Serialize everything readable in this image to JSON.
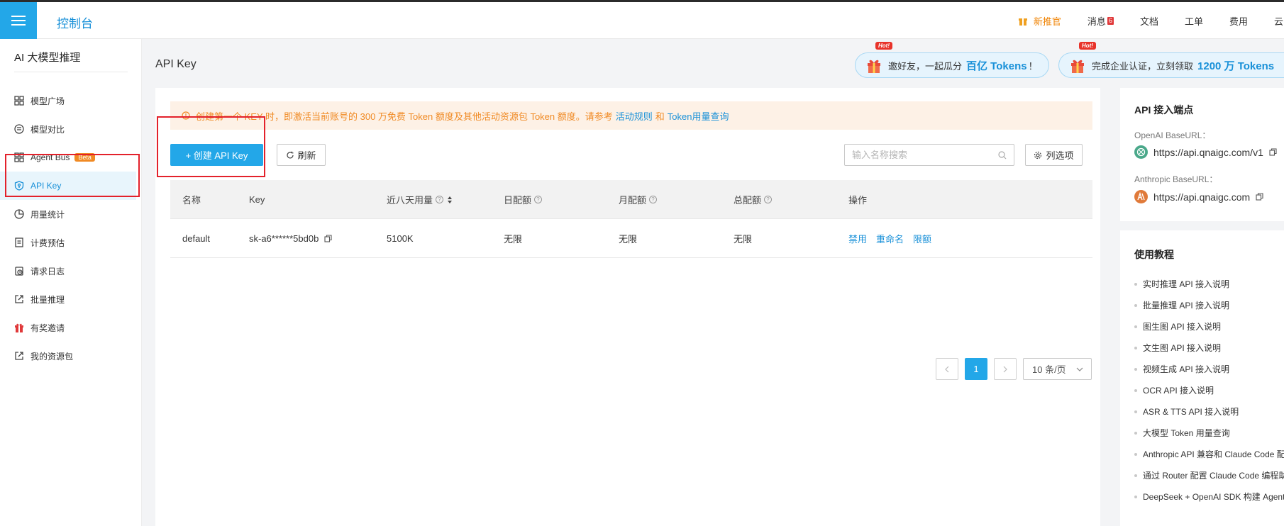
{
  "topbar": {
    "brand": "控制台",
    "nav": [
      "新推官",
      "消息",
      "文档",
      "工单",
      "费用",
      "云"
    ],
    "msg_badge": "6"
  },
  "sidebar": {
    "title": "AI 大模型推理",
    "items": [
      {
        "label": "模型广场",
        "icon": "grid-icon"
      },
      {
        "label": "模型对比",
        "icon": "compare-icon"
      },
      {
        "label": "Agent Bus",
        "icon": "grid-icon",
        "badge": "Beta"
      },
      {
        "label": "API Key",
        "icon": "shield-key-icon",
        "active": true
      },
      {
        "label": "用量统计",
        "icon": "pie-chart-icon"
      },
      {
        "label": "计费预估",
        "icon": "document-icon"
      },
      {
        "label": "请求日志",
        "icon": "clock-log-icon"
      },
      {
        "label": "批量推理",
        "icon": "external-icon"
      },
      {
        "label": "有奖邀请",
        "icon": "gift-icon"
      },
      {
        "label": "我的资源包",
        "icon": "external-icon"
      }
    ]
  },
  "page": {
    "title": "API Key"
  },
  "promos": [
    {
      "hot": "Hot!",
      "text": "邀好友，一起瓜分",
      "strong": "百亿 Tokens",
      "suffix": "！"
    },
    {
      "hot": "Hot!",
      "text": "完成企业认证，立刻领取",
      "strong": "1200 万 Tokens",
      "suffix": ""
    }
  ],
  "notice": {
    "icon": "alert-circle-icon",
    "text": "创建第一个 KEY 时，即激活当前账号的 300 万免费 Token 额度及其他活动资源包 Token 额度。请参考",
    "link1": "活动规则",
    "and": "和",
    "link2": "Token用量查询"
  },
  "toolbar": {
    "create_label": "+ 创建 API Key",
    "refresh_label": "刷新",
    "search_placeholder": "输入名称搜索",
    "columns_label": "列选项"
  },
  "table": {
    "headers": [
      "名称",
      "Key",
      "近八天用量",
      "日配额",
      "月配额",
      "总配额",
      "操作"
    ],
    "rows": [
      {
        "name": "default",
        "key": "sk-a6******5bd0b",
        "usage": "5100K",
        "daily": "无限",
        "monthly": "无限",
        "total": "无限",
        "actions": [
          "禁用",
          "重命名",
          "限额"
        ]
      }
    ]
  },
  "pagination": {
    "current": "1",
    "page_size": "10 条/页"
  },
  "endpoints": {
    "title": "API 接入端点",
    "openai_label": "OpenAI BaseURL：",
    "openai_url": "https://api.qnaigc.com/v1",
    "anthropic_label": "Anthropic BaseURL：",
    "anthropic_url": "https://api.qnaigc.com"
  },
  "tutorials": {
    "title": "使用教程",
    "items": [
      "实时推理 API 接入说明",
      "批量推理 API 接入说明",
      "图生图 API 接入说明",
      "文生图 API 接入说明",
      "视频生成 API 接入说明",
      "OCR API 接入说明",
      "ASR & TTS API 接入说明",
      "大模型 Token 用量查询",
      "Anthropic API 兼容和 Claude Code 配置",
      "通过 Router 配置 Claude Code 编程助手",
      "DeepSeek + OpenAI SDK 构建 Agent"
    ]
  },
  "colors": {
    "accent": "#23a7e8",
    "link": "#1890d8",
    "warning": "#f08a24",
    "highlight_box": "#e3212b"
  }
}
